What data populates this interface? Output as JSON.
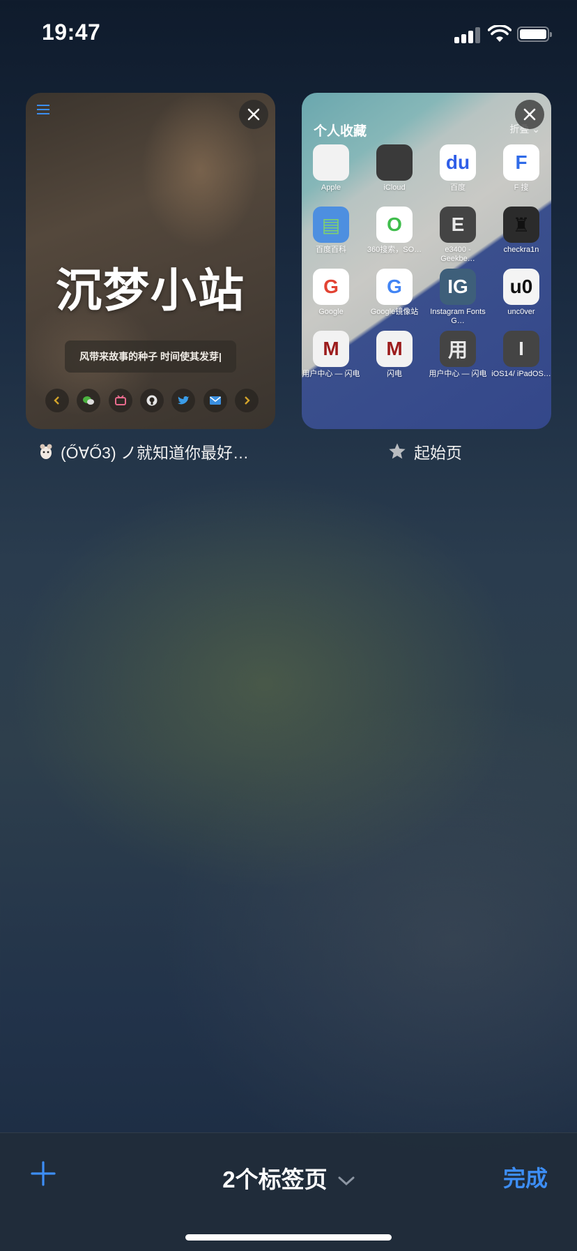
{
  "status": {
    "time": "19:47"
  },
  "tabs": [
    {
      "site_title": "沉梦小站",
      "motto": "风带来故事的种子 时间使其发芽|",
      "caption": "(Ő∀Ő3) ノ就知道你最好…",
      "social_icons": [
        "chevron-left-icon",
        "wechat-icon",
        "bilibili-icon",
        "github-icon",
        "twitter-icon",
        "mail-icon",
        "chevron-right-icon"
      ]
    },
    {
      "section_title": "个人收藏",
      "fold_label": "折叠",
      "caption": "起始页",
      "apps": [
        {
          "label": "Apple",
          "glyph": "",
          "bg": "#f2f2f2",
          "fg": "#8a8a8a"
        },
        {
          "label": "iCloud",
          "glyph": "",
          "bg": "#3a3a3a",
          "fg": "#bdbdbd"
        },
        {
          "label": "百度",
          "glyph": "du",
          "bg": "#ffffff",
          "fg": "#2f5ee8"
        },
        {
          "label": "F 搜",
          "glyph": "F",
          "bg": "#ffffff",
          "fg": "#2f6be8"
        },
        {
          "label": "百度百科",
          "glyph": "▤",
          "bg": "#4d8fe0",
          "fg": "#7fd16f"
        },
        {
          "label": "360搜索，SO…",
          "glyph": "O",
          "bg": "#ffffff",
          "fg": "#3fbd4c"
        },
        {
          "label": "e3400 - Geekbe…",
          "glyph": "E",
          "bg": "#444444",
          "fg": "#e8e8e8"
        },
        {
          "label": "checkra1n",
          "glyph": "♜",
          "bg": "#2b2b2b",
          "fg": "#111111"
        },
        {
          "label": "Google",
          "glyph": "G",
          "bg": "#ffffff",
          "fg": "#e24333"
        },
        {
          "label": "Google镜像站",
          "glyph": "G",
          "bg": "#ffffff",
          "fg": "#4285f4"
        },
        {
          "label": "Instagram Fonts G…",
          "glyph": "IG",
          "bg": "#3e5f7a",
          "fg": "#ffffff"
        },
        {
          "label": "unc0ver",
          "glyph": "u0",
          "bg": "#f4f4f4",
          "fg": "#111111"
        },
        {
          "label": "用户中心 — 闪电",
          "glyph": "M",
          "bg": "#f2f2f2",
          "fg": "#9c1c1c"
        },
        {
          "label": "闪电",
          "glyph": "M",
          "bg": "#f2f2f2",
          "fg": "#9c1c1c"
        },
        {
          "label": "用户中心 — 闪电",
          "glyph": "用",
          "bg": "#444444",
          "fg": "#e8e8e8"
        },
        {
          "label": "iOS14/ iPadOS…",
          "glyph": "I",
          "bg": "#444444",
          "fg": "#e8e8e8"
        }
      ]
    }
  ],
  "toolbar": {
    "tab_count": "2个标签页",
    "done": "完成"
  }
}
